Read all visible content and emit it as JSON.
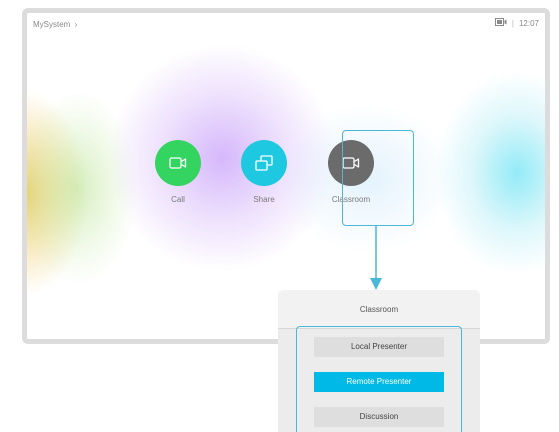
{
  "header": {
    "system_name": "MySystem",
    "chevron": "›",
    "separator": "|",
    "time": "12:07",
    "status_icon": "screen-share-status-icon"
  },
  "actions": [
    {
      "label": "Call",
      "icon": "video-camera-icon",
      "color": "#33d45f"
    },
    {
      "label": "Share",
      "icon": "share-screens-icon",
      "color": "#1ec8e0"
    },
    {
      "label": "Classroom",
      "icon": "video-camera-icon",
      "color": "#6b6b6b"
    }
  ],
  "classroom_panel": {
    "title": "Classroom",
    "options": [
      {
        "label": "Local Presenter",
        "selected": false
      },
      {
        "label": "Remote Presenter",
        "selected": true
      },
      {
        "label": "Discussion",
        "selected": false
      }
    ],
    "accent_color": "#00b9e6",
    "highlight_color": "#4cb8d8"
  }
}
